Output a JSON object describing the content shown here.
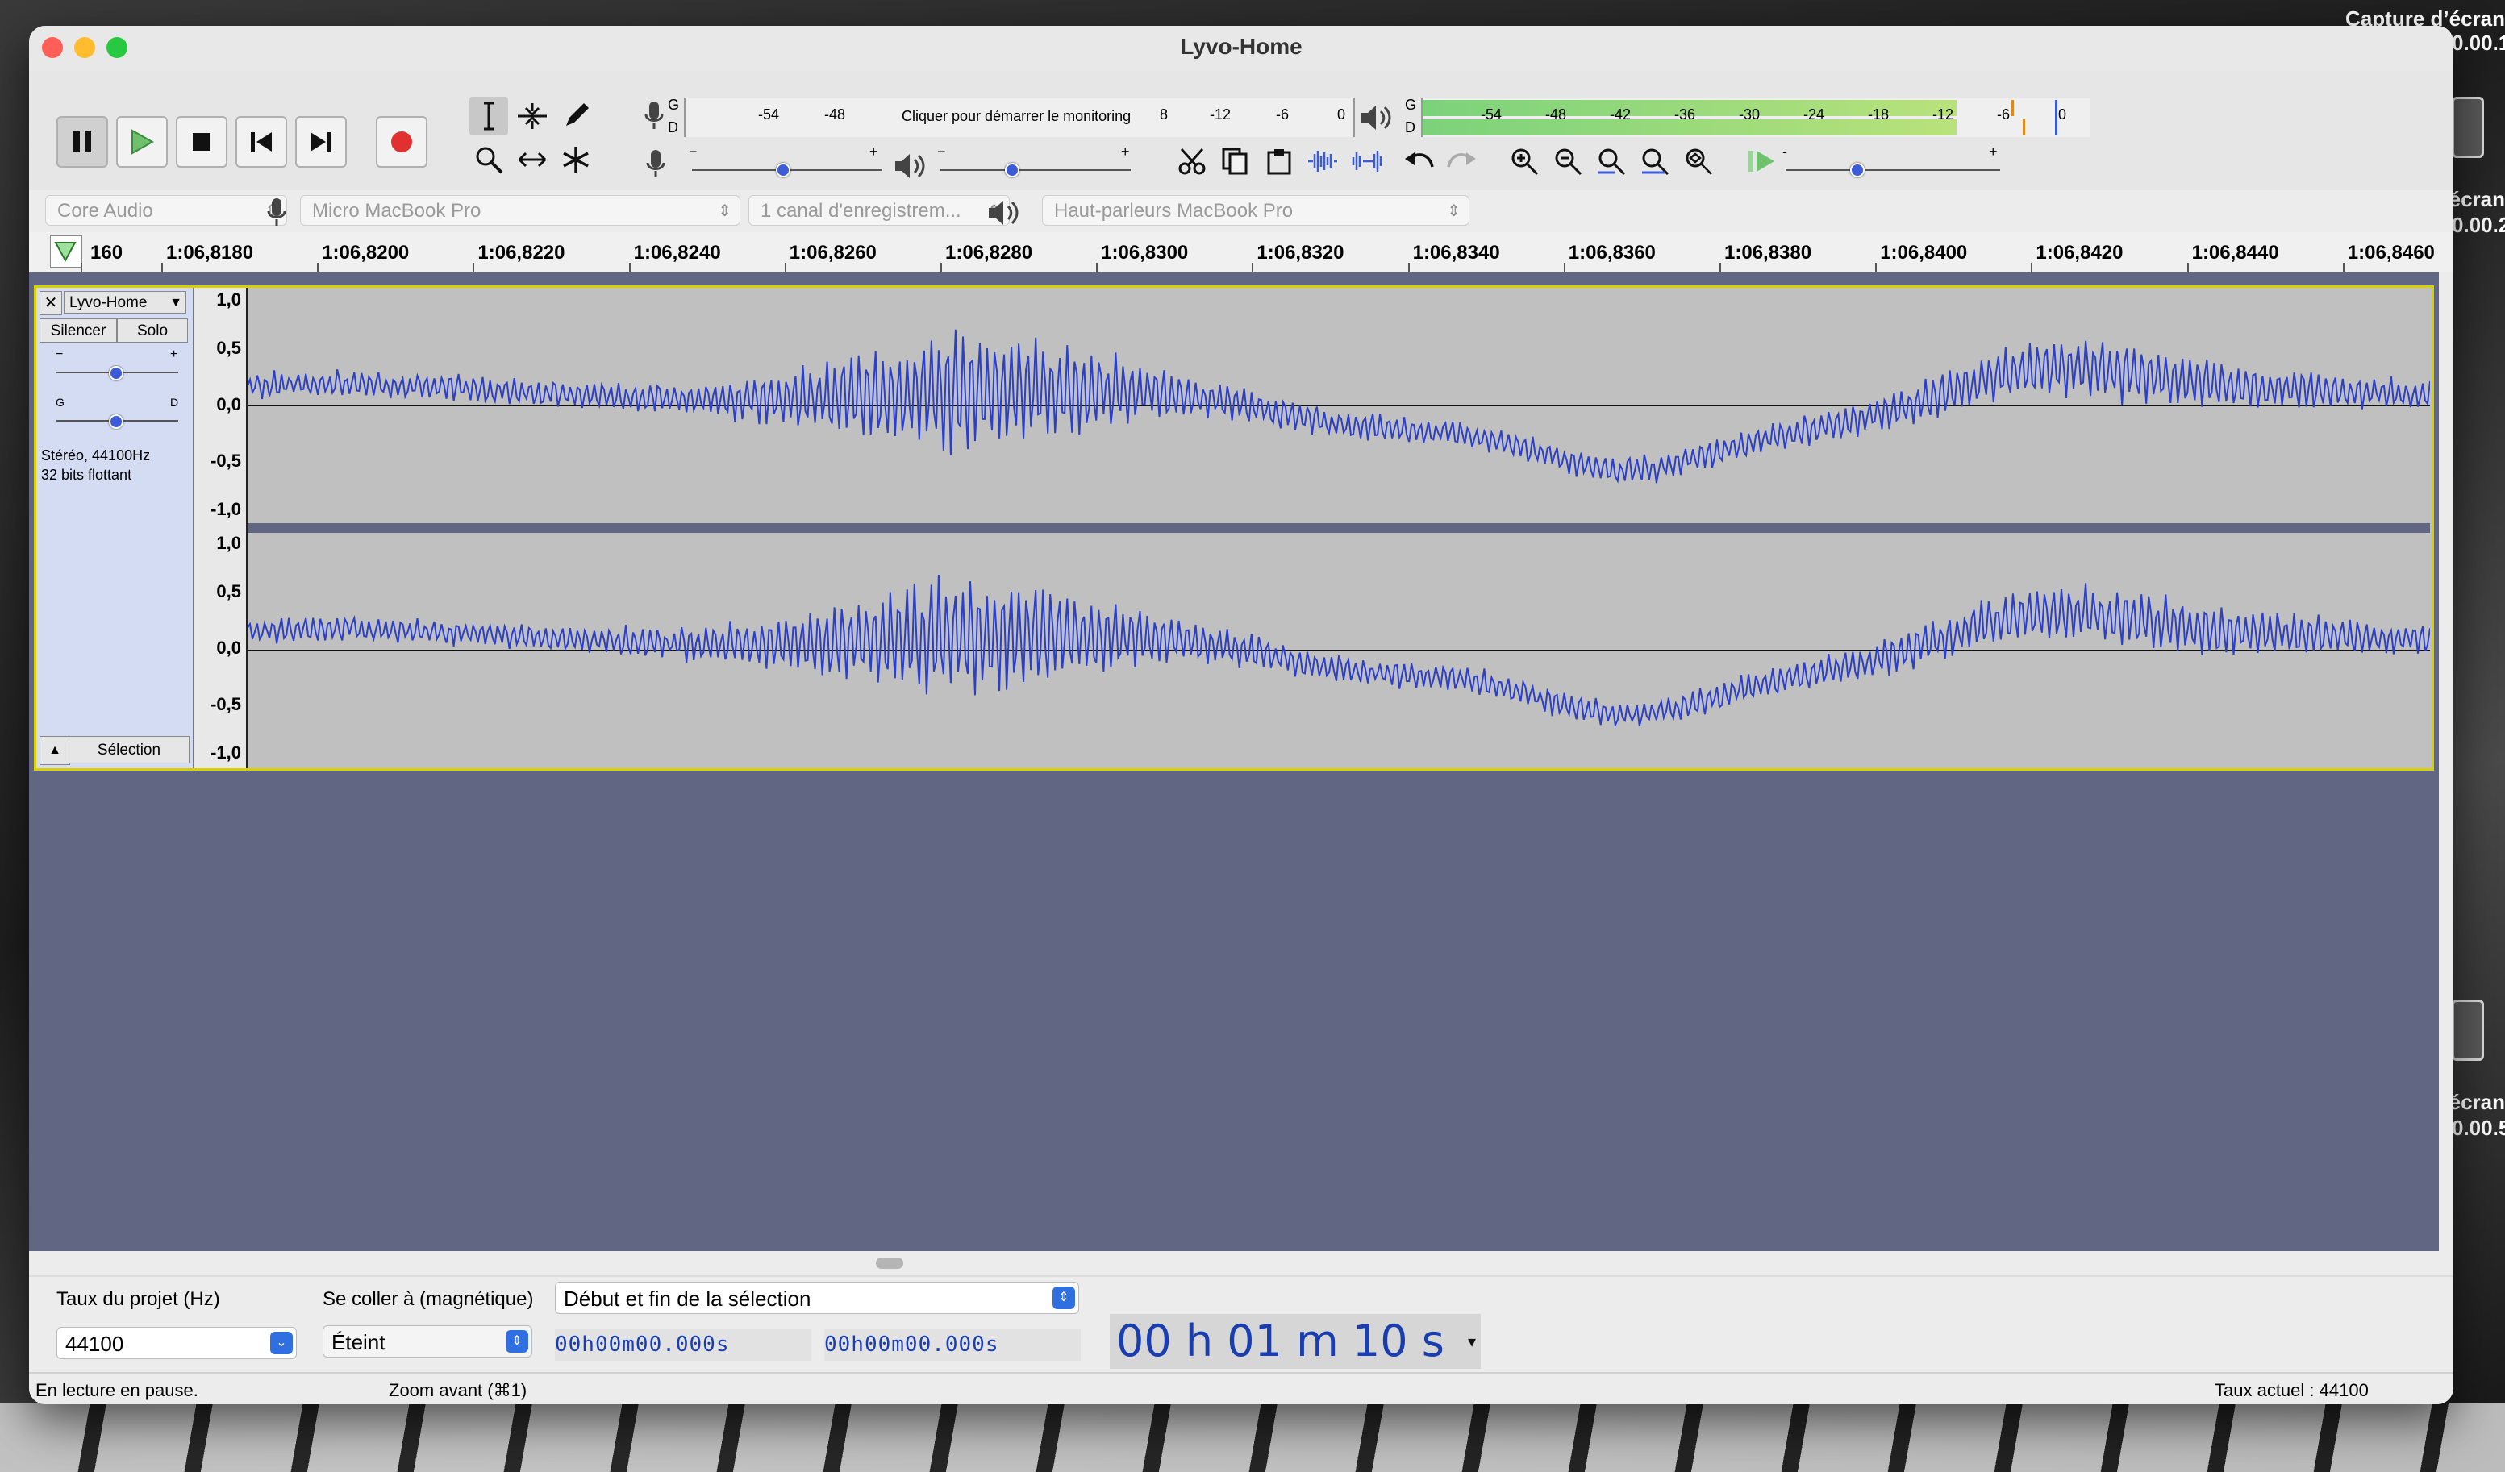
{
  "window": {
    "title": "Lyvo-Home"
  },
  "desktop": {
    "labels": [
      "Capture d’écran",
      "0.00.1",
      "écran",
      "0.00.2",
      "écran",
      "0.00.5"
    ]
  },
  "meters": {
    "record_prompt": "Cliquer pour démarrer le monitoring",
    "record_scale": [
      "-54",
      "-48",
      "8",
      "-12",
      "-6",
      "0"
    ],
    "play_scale": [
      "-54",
      "-48",
      "-42",
      "-36",
      "-30",
      "-24",
      "-18",
      "-12",
      "-6",
      "0"
    ],
    "left_label": "G",
    "right_label": "D",
    "play_level_fraction": 0.8
  },
  "sliders": {
    "minus": "−",
    "plus": "+",
    "playback_speed_minus": "-",
    "playback_speed_plus": "+"
  },
  "devices": {
    "host": "Core Audio",
    "input": "Micro MacBook Pro",
    "channels": "1 canal d'enregistrem...",
    "output": "Haut-parleurs MacBook Pro"
  },
  "ruler": {
    "labels": [
      "160",
      "1:06,8180",
      "1:06,8200",
      "1:06,8220",
      "1:06,8240",
      "1:06,8260",
      "1:06,8280",
      "1:06,8300",
      "1:06,8320",
      "1:06,8340",
      "1:06,8360",
      "1:06,8380",
      "1:06,8400",
      "1:06,8420",
      "1:06,8440",
      "1:06,8460"
    ]
  },
  "track": {
    "name": "Lyvo-Home",
    "mute": "Silencer",
    "solo": "Solo",
    "gain_minus": "−",
    "gain_plus": "+",
    "pan_left": "G",
    "pan_right": "D",
    "info_line1": "Stéréo, 44100Hz",
    "info_line2": "32 bits flottant",
    "select": "Sélection",
    "scale": [
      "1,0",
      "0,5",
      "0,0",
      "-0,5",
      "-1,0"
    ]
  },
  "selection_bar": {
    "rate_label": "Taux du projet (Hz)",
    "rate_value": "44100",
    "snap_label": "Se coller à (magnétique)",
    "snap_value": "Éteint",
    "sel_mode": "Début et fin de la sélection",
    "start_time": "00h00m00.000s",
    "end_time": "00h00m00.000s",
    "position": "00 h 01 m 10 s"
  },
  "status": {
    "left": "En lecture en pause.",
    "middle": "Zoom avant (⌘1)",
    "right": "Taux actuel : 44100"
  },
  "colors": {
    "waveform": "#2b3fc8",
    "track_bg": "#c0c0c0",
    "tracks_area": "#616783",
    "selected_border": "#d8d000"
  }
}
